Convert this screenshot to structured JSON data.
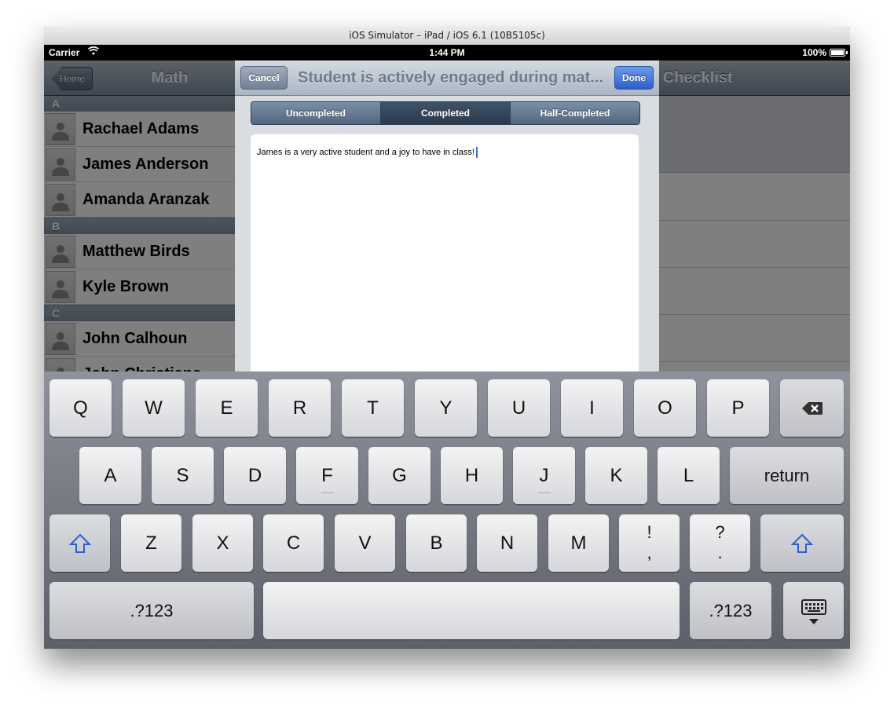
{
  "window_title": "iOS Simulator – iPad / iOS 6.1 (10B5105c)",
  "statusbar": {
    "carrier": "Carrier",
    "time": "1:44 PM",
    "battery": "100%"
  },
  "master": {
    "back_label": "Home",
    "title": "Math",
    "sections": [
      {
        "header": "A",
        "students": [
          "Rachael Adams",
          "James Anderson",
          "Amanda Aranzak"
        ]
      },
      {
        "header": "B",
        "students": [
          "Matthew Birds",
          "Kyle Brown"
        ]
      },
      {
        "header": "C",
        "students": [
          "John Calhoun",
          "John Christians"
        ]
      }
    ]
  },
  "detail": {
    "title": "d Checklist"
  },
  "modal": {
    "cancel_label": "Cancel",
    "title": "Student is actively engaged during mat...",
    "done_label": "Done",
    "segments": [
      "Uncompleted",
      "Completed",
      "Half-Completed"
    ],
    "selected_segment": "Completed",
    "note_text": "James is a very active student and a joy to have in class!"
  },
  "keyboard": {
    "row1": [
      "Q",
      "W",
      "E",
      "R",
      "T",
      "Y",
      "U",
      "I",
      "O",
      "P"
    ],
    "row2": [
      "A",
      "S",
      "D",
      "F",
      "G",
      "H",
      "J",
      "K",
      "L"
    ],
    "row3": [
      "Z",
      "X",
      "C",
      "V",
      "B",
      "N",
      "M"
    ],
    "return_label": "return",
    "punct1": {
      "top": "!",
      "bottom": ","
    },
    "punct2": {
      "top": "?",
      "bottom": "."
    },
    "numbers_label": ".?123"
  },
  "colors": {
    "accent_blue": "#2d5fce",
    "navbar": "#8c9db1"
  }
}
